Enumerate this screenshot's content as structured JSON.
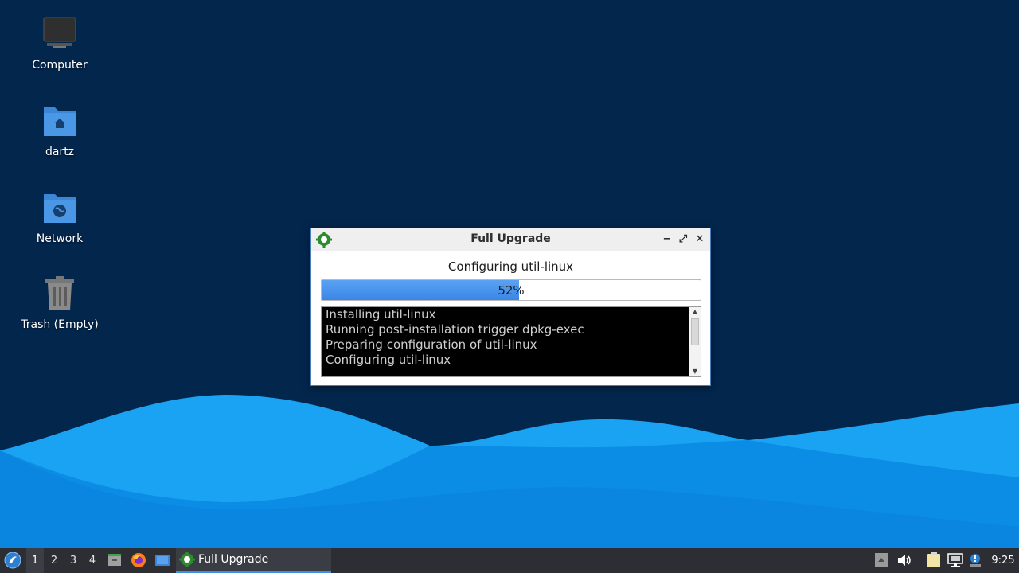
{
  "desktop": {
    "icons": [
      {
        "label": "Computer",
        "icon": "computer-icon"
      },
      {
        "label": "dartz",
        "icon": "home-folder-icon"
      },
      {
        "label": "Network",
        "icon": "network-folder-icon"
      },
      {
        "label": "Trash (Empty)",
        "icon": "trash-icon"
      }
    ]
  },
  "dialog": {
    "title": "Full Upgrade",
    "status": "Configuring util-linux",
    "progress": {
      "percent": 52,
      "label": "52%"
    },
    "log_lines": [
      "Installing util-linux",
      "Running post-installation trigger dpkg-exec",
      "Preparing configuration of util-linux",
      "Configuring util-linux"
    ],
    "controls": {
      "minimize": "−",
      "maximize": "⤢",
      "close": "✕"
    }
  },
  "taskbar": {
    "workspaces": [
      "1",
      "2",
      "3",
      "4"
    ],
    "active_workspace": "1",
    "launchers": [
      "file-manager-icon",
      "firefox-icon",
      "desktop-icon"
    ],
    "task": {
      "label": "Full Upgrade",
      "icon": "gear-icon"
    },
    "tray": [
      "panel-hide-icon",
      "volume-icon",
      "clipboard-icon",
      "network-icon",
      "notification-icon"
    ],
    "clock": "9:25"
  },
  "colors": {
    "wallpaper_dark": "#03264d",
    "wave_light": "#1ea6f5",
    "wave_mid": "#0f8fe8",
    "progress_fill": "#3a86e6",
    "taskbar": "#2c2e33",
    "accent": "#3d8fe6"
  }
}
